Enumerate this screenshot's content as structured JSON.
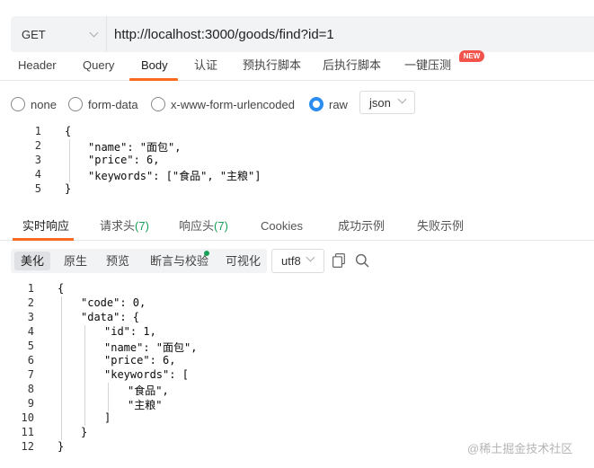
{
  "request": {
    "method": "GET",
    "url": "http://localhost:3000/goods/find?id=1"
  },
  "request_tabs": [
    {
      "label": "Header"
    },
    {
      "label": "Query"
    },
    {
      "label": "Body",
      "active": true
    },
    {
      "label": "认证"
    },
    {
      "label": "预执行脚本"
    },
    {
      "label": "后执行脚本"
    },
    {
      "label": "一键压测",
      "badge": "NEW"
    }
  ],
  "body_types": [
    {
      "label": "none",
      "selected": false
    },
    {
      "label": "form-data",
      "selected": false
    },
    {
      "label": "x-www-form-urlencoded",
      "selected": false
    },
    {
      "label": "raw",
      "selected": true
    }
  ],
  "raw_format": "json",
  "request_body_lines": [
    {
      "num": "1",
      "text": "{"
    },
    {
      "num": "2",
      "text": "\"name\": \"面包\","
    },
    {
      "num": "3",
      "text": "\"price\": 6,"
    },
    {
      "num": "4",
      "text": "\"keywords\": [\"食品\", \"主粮\"]"
    },
    {
      "num": "5",
      "text": "}"
    }
  ],
  "response_tabs": [
    {
      "label": "实时响应",
      "active": true
    },
    {
      "label": "请求头",
      "count": "(7)"
    },
    {
      "label": "响应头",
      "count": "(7)"
    },
    {
      "label": "Cookies"
    },
    {
      "label": "成功示例"
    },
    {
      "label": "失败示例"
    }
  ],
  "view_modes": [
    {
      "label": "美化",
      "active": true
    },
    {
      "label": "原生"
    },
    {
      "label": "预览"
    },
    {
      "label": "断言与校验"
    },
    {
      "label": "可视化"
    }
  ],
  "encoding": "utf8",
  "response_lines": [
    {
      "num": "1",
      "text": "{"
    },
    {
      "num": "2",
      "text": "\"code\": 0,"
    },
    {
      "num": "3",
      "text": "\"data\": {"
    },
    {
      "num": "4",
      "text": "\"id\": 1,"
    },
    {
      "num": "5",
      "text": "\"name\": \"面包\","
    },
    {
      "num": "6",
      "text": "\"price\": 6,"
    },
    {
      "num": "7",
      "text": "\"keywords\": ["
    },
    {
      "num": "8",
      "text": "\"食品\","
    },
    {
      "num": "9",
      "text": "\"主粮\""
    },
    {
      "num": "10",
      "text": "]"
    },
    {
      "num": "11",
      "text": "}"
    },
    {
      "num": "12",
      "text": "}"
    }
  ],
  "watermark": "@稀土掘金技术社区",
  "colors": {
    "accent": "#fa6a1e",
    "radio_selected": "#2d8cf0",
    "badge": "#f2544b",
    "count": "#18a058"
  }
}
